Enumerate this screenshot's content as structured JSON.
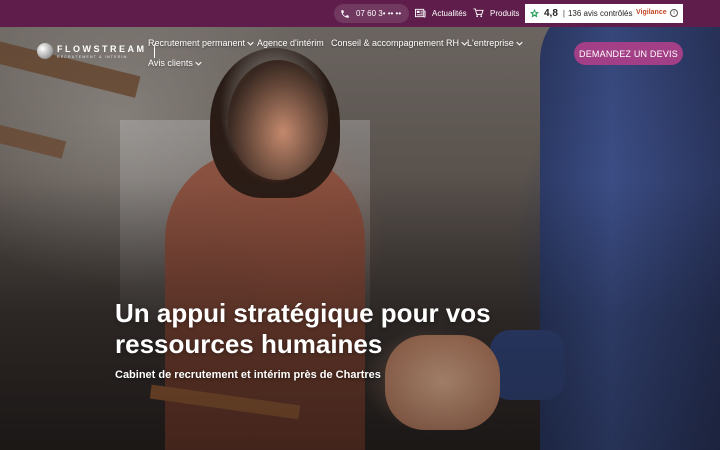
{
  "topbar": {
    "phone": "07 60 3• •• ••",
    "links": [
      {
        "label": "Actualités",
        "icon": "newspaper-icon"
      },
      {
        "label": "Produits",
        "icon": "cart-icon"
      }
    ],
    "rating": {
      "score": "4,8",
      "count": "136 avis contrôlés",
      "provider": "Vigilance",
      "icon": "star-icon"
    }
  },
  "brand": {
    "name": "FLOWSTREAM",
    "tagline": "RECRUTEMENT & INTERIM"
  },
  "nav": {
    "items": [
      {
        "label": "Recrutement permanent",
        "dropdown": true
      },
      {
        "label": "Agence d'intérim",
        "dropdown": false
      },
      {
        "label": "Conseil & accompagnement RH",
        "dropdown": true
      },
      {
        "label": "L'entreprise",
        "dropdown": true
      },
      {
        "label": "Avis clients",
        "dropdown": true
      }
    ],
    "cta": "DEMANDEZ UN DEVIS"
  },
  "hero": {
    "title": "Un appui stratégique pour vos ressources humaines",
    "subtitle": "Cabinet de recrutement et intérim près de Chartres"
  },
  "colors": {
    "topbar": "#5e1d4a",
    "cta": "#a33f86",
    "rating_accent": "#1f9d55",
    "vigilance": "#c3492a"
  }
}
